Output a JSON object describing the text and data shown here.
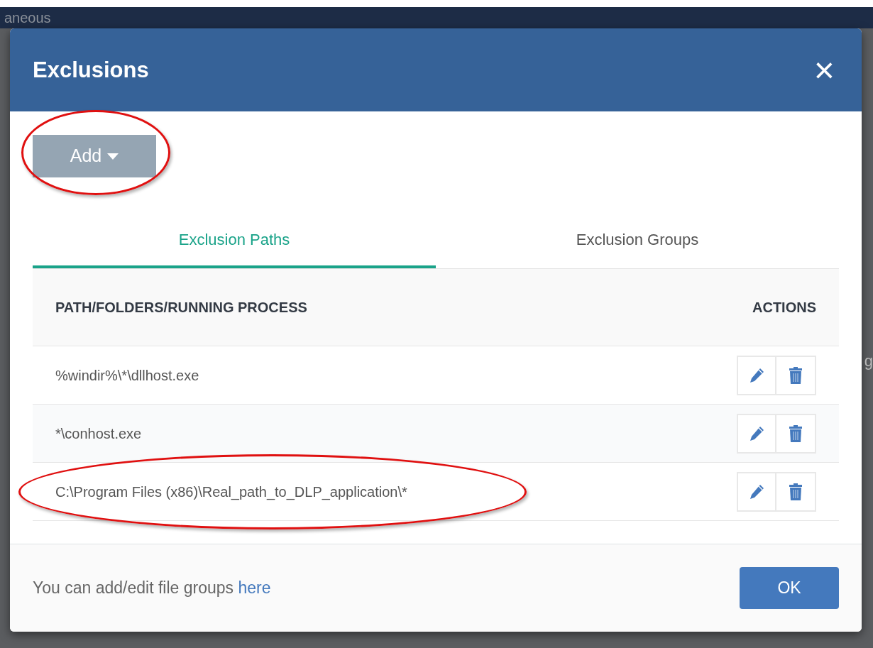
{
  "background": {
    "top_text": "aneous",
    "side_text": "g"
  },
  "dialog": {
    "title": "Exclusions",
    "close": "×"
  },
  "add_button": {
    "label": "Add",
    "circled": true
  },
  "tabs": [
    {
      "label": "Exclusion Paths",
      "selected": true
    },
    {
      "label": "Exclusion Groups",
      "selected": false
    }
  ],
  "table": {
    "columns": [
      "PATH/FOLDERS/RUNNING PROCESS",
      "ACTIONS"
    ],
    "rows": [
      {
        "path": "%windir%\\*\\dllhost.exe",
        "circled": false
      },
      {
        "path": "*\\conhost.exe",
        "circled": false
      },
      {
        "path": "C:\\Program Files (x86)\\Real_path_to_DLP_application\\*",
        "circled": true
      }
    ]
  },
  "footer": {
    "note": "You can add/edit file groups",
    "link": "here",
    "ok": "OK"
  }
}
